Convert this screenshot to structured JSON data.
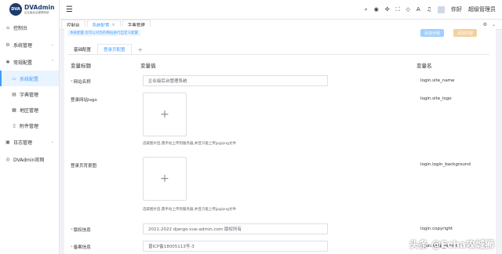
{
  "brand": {
    "badge": "DVA",
    "title": "DVAdmin",
    "subtitle": "企业级后台管理系统"
  },
  "sidebar": {
    "items": [
      {
        "label": "控制台",
        "icon": "home-icon"
      },
      {
        "label": "系统管理",
        "icon": "gear-icon",
        "arrow": "⌄"
      },
      {
        "label": "常规配置",
        "icon": "settings-icon",
        "arrow": "⌃"
      },
      {
        "label": "系统配置",
        "icon": "monitor-icon",
        "active": true
      },
      {
        "label": "字典管理",
        "icon": "book-icon"
      },
      {
        "label": "地区管理",
        "icon": "map-icon"
      },
      {
        "label": "附件管理",
        "icon": "file-icon"
      },
      {
        "label": "日志管理",
        "icon": "log-icon",
        "arrow": "⌄"
      },
      {
        "label": "DVAdmin官网",
        "icon": "globe-icon"
      }
    ]
  },
  "header": {
    "user_greeting": "你好",
    "user_name": "超级管理员"
  },
  "tabs": [
    {
      "label": "控制台"
    },
    {
      "label": "系统配置",
      "close": "×",
      "active": true
    },
    {
      "label": "字典管理"
    }
  ],
  "content": {
    "notice": "系统配置:您可以对您的网站进行自定义配置",
    "btn_add_group": "添加分组",
    "btn_add_content": "添加内容",
    "subtabs": [
      {
        "label": "基础配置"
      },
      {
        "label": "登录页配置",
        "active": true
      },
      {
        "label": "+"
      }
    ],
    "columns": {
      "title": "变量标题",
      "value": "变量值",
      "name": "变量名"
    },
    "rows": {
      "site_name": {
        "label": "网站名称",
        "value": "企业级后台管理系统",
        "var": "login.site_name"
      },
      "site_logo": {
        "label": "登录网站logo",
        "hint": "选取图片后,需手动上传到服务器,并且只能上传jpg/png文件",
        "var": "login.site_logo"
      },
      "login_background": {
        "label": "登录页背景图",
        "hint": "选取图片后,需手动上传到服务器,并且只能上传jpg/png文件",
        "var": "login.login_background"
      },
      "copyright": {
        "label": "版权信息",
        "value": "2021-2022 django-vue-admin.com 版权所有",
        "var": "login.copyright"
      },
      "keep_record": {
        "label": "备案信息",
        "value": "晋ICP备18005113号-3",
        "var": "login.keep_record"
      }
    }
  },
  "watermark": "头条 @Echa攻城狮",
  "colors": {
    "accent": "#409eff",
    "required": "#f56c6c",
    "brand": "#1d3b6b"
  }
}
